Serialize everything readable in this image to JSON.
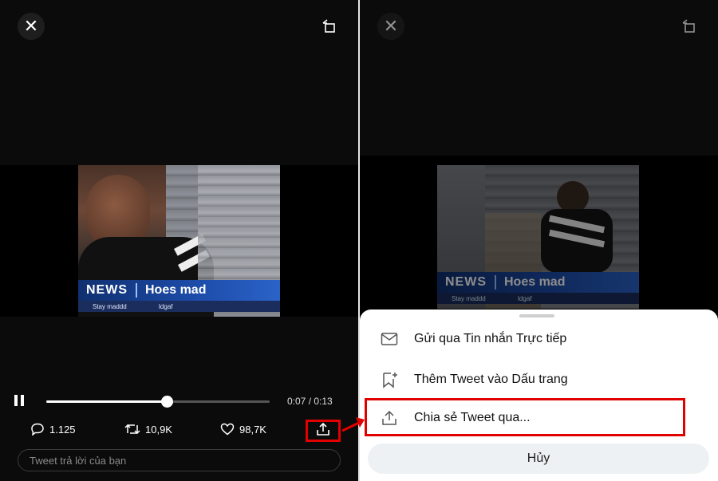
{
  "video": {
    "news_word": "NEWS",
    "headline": "Hoes mad",
    "subtext_left": "Stay maddd",
    "subtext_right": "Idgaf"
  },
  "player": {
    "current_time": "0:07",
    "duration": "0:13",
    "time_separator": " / ",
    "progress_fraction": 0.54
  },
  "stats": {
    "replies": "1.125",
    "retweets": "10,9K",
    "likes": "98,7K"
  },
  "reply_placeholder": "Tweet trả lời của bạn",
  "share_sheet": {
    "items": [
      {
        "label": "Gửi qua Tin nhắn Trực tiếp",
        "icon": "mail-icon"
      },
      {
        "label": "Thêm Tweet vào Dấu trang",
        "icon": "bookmark-add-icon"
      },
      {
        "label": "Chia sẻ Tweet qua...",
        "icon": "share-icon"
      }
    ],
    "cancel": "Hủy"
  },
  "colors": {
    "highlight": "#e00000",
    "news_blue": "#1c4aa6",
    "background": "#0b0b0b"
  }
}
